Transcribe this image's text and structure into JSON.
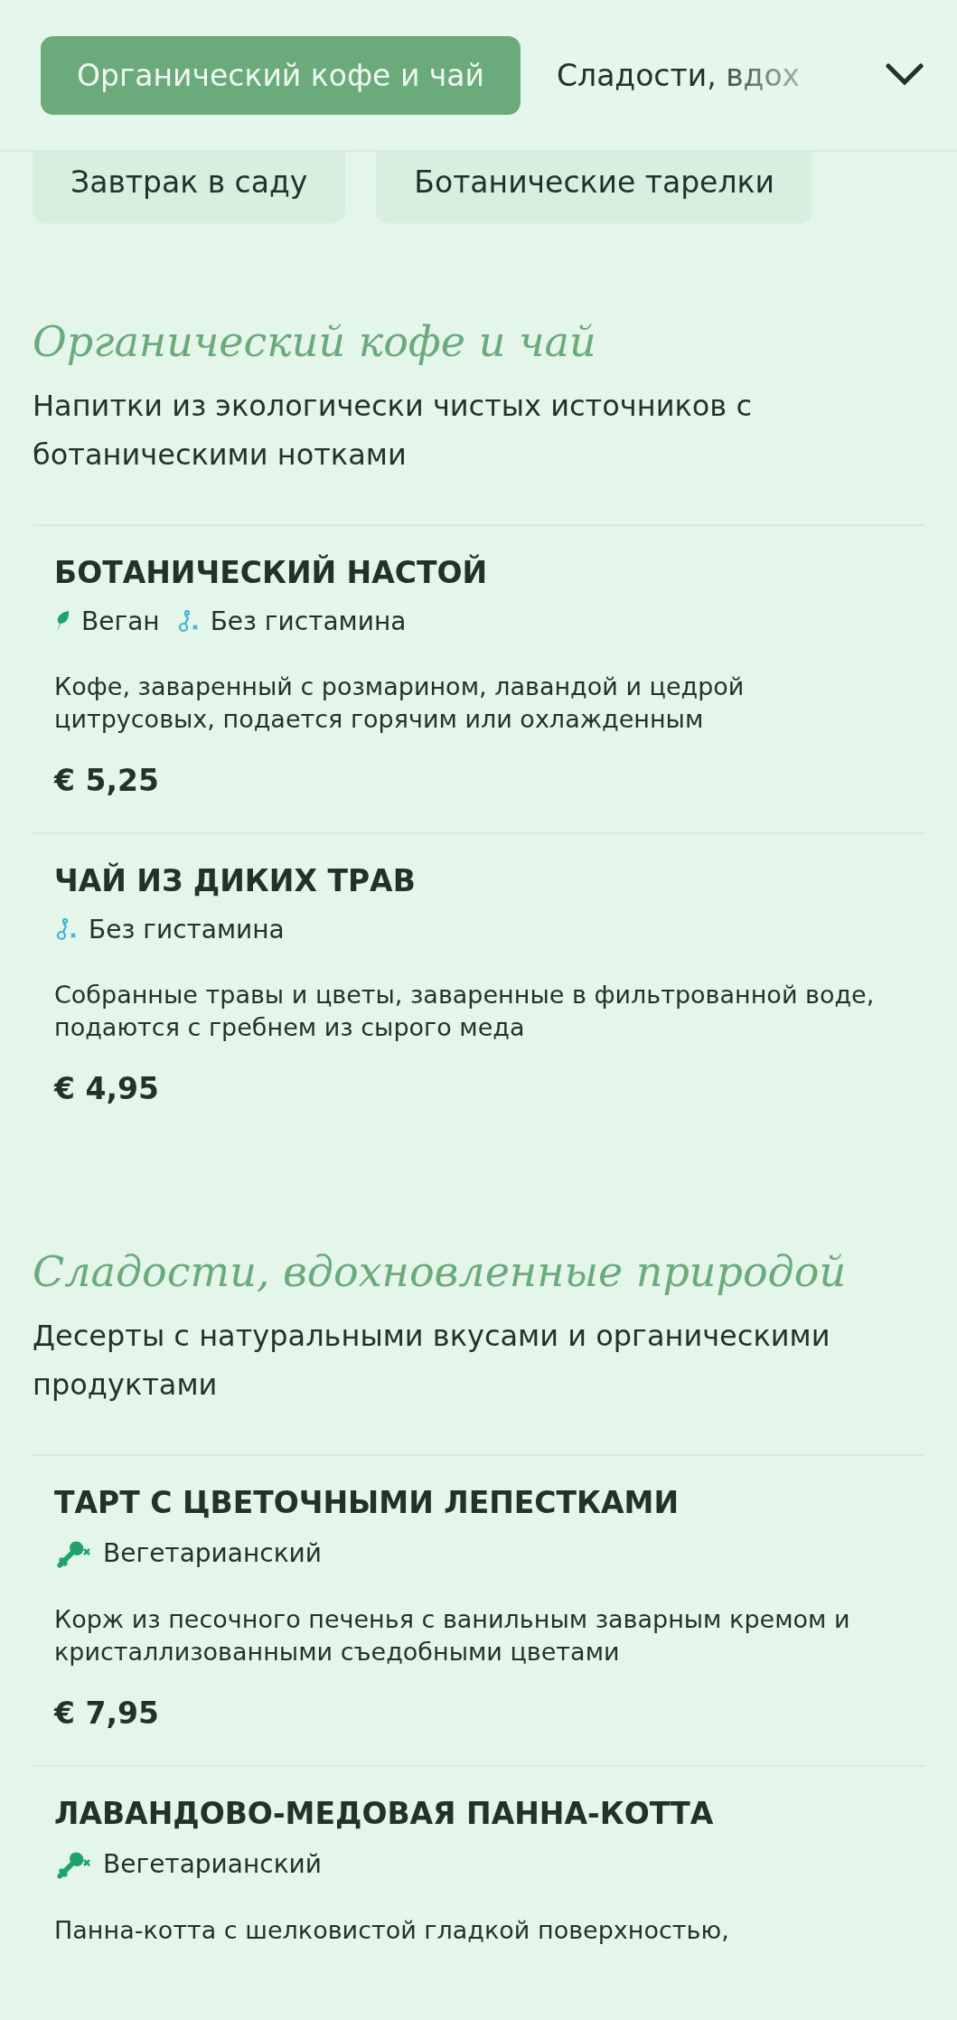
{
  "tabs": [
    {
      "label": "Органический кофе и чай",
      "selected": true
    },
    {
      "label": "Сладости, вдох",
      "selected": false
    }
  ],
  "chips": [
    {
      "label": "Завтрак в саду"
    },
    {
      "label": "Ботанические тарелки"
    }
  ],
  "sections": [
    {
      "title": "Органический кофе и чай",
      "description": "Напитки из экологически чистых источников с ботаническими нотками",
      "items": [
        {
          "name": "БОТАНИЧЕСКИЙ НАСТОЙ",
          "tags": [
            {
              "kind": "vegan",
              "label": "Веган"
            },
            {
              "kind": "histamine",
              "label": "Без гистамина"
            }
          ],
          "description": "Кофе, заваренный с розмарином, лавандой и цедрой цитрусовых, подается горячим или охлажденным",
          "price": "€ 5,25"
        },
        {
          "name": "ЧАЙ ИЗ ДИКИХ ТРАВ",
          "tags": [
            {
              "kind": "histamine",
              "label": "Без гистамина"
            }
          ],
          "description": "Собранные травы и цветы, заваренные в фильтрованной воде, подаются с гребнем из сырого меда",
          "price": "€ 4,95"
        }
      ]
    },
    {
      "title": "Сладости, вдохновленные природой",
      "description": "Десерты с натуральными вкусами и органическими продуктами",
      "items": [
        {
          "name": "ТАРТ С ЦВЕТОЧНЫМИ ЛЕПЕСТКАМИ",
          "tags": [
            {
              "kind": "vegetarian",
              "label": "Вегетарианский"
            }
          ],
          "description": "Корж из песочного печенья с ванильным заварным кремом и кристаллизованными съедобными цветами",
          "price": "€ 7,95"
        },
        {
          "name": "ЛАВАНДОВО-МЕДОВАЯ ПАННА-КОТТА",
          "tags": [
            {
              "kind": "vegetarian",
              "label": "Вегетарианский"
            }
          ],
          "description": "Панна-котта с шелковистой гладкой поверхностью,"
        }
      ]
    }
  ]
}
